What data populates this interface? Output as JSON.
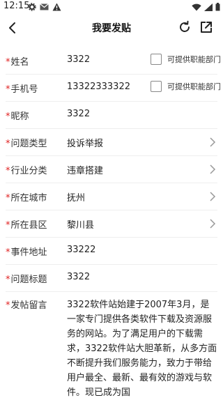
{
  "status_bar": {
    "time": "12:15"
  },
  "header": {
    "title": "我要发贴"
  },
  "form": {
    "required_mark": "*",
    "name": {
      "label": "姓名",
      "value": "3322",
      "option_label": "可提供职能部门"
    },
    "phone": {
      "label": "手机号",
      "value": "13322333322",
      "option_label": "可提供职能部门"
    },
    "nickname": {
      "label": "昵称",
      "value": "3322"
    },
    "issue_type": {
      "label": "问题类型",
      "value": "投诉举报"
    },
    "industry": {
      "label": "行业分类",
      "value": "违章搭建"
    },
    "city": {
      "label": "所在城市",
      "value": "抚州"
    },
    "county": {
      "label": "所在县区",
      "value": "黎川县"
    },
    "address": {
      "label": "事件地址",
      "value": "33222"
    },
    "issue_title": {
      "label": "问题标题",
      "value": "3322"
    },
    "message": {
      "label": "发帖留言",
      "value": "3322软件站始建于2007年3月，是一家专门提供各类软件下载及资源服务的网站。为了满足用户的下载需求，3322软件站大胆革新，从多方面不断提升我们服务能力，致力于带给用户最全、最新、最有效的游戏与软件。现已成为国"
    }
  }
}
